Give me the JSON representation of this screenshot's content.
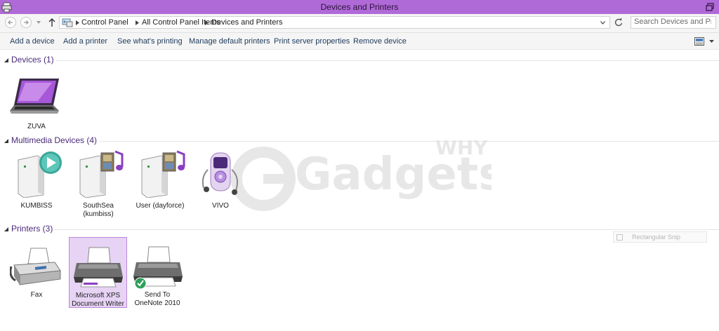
{
  "window": {
    "title": "Devices and Printers"
  },
  "address": {
    "crumbs": [
      "Control Panel",
      "All Control Panel Items",
      "Devices and Printers"
    ]
  },
  "search": {
    "placeholder": "Search Devices and Printers"
  },
  "commands": [
    "Add a device",
    "Add a printer",
    "See what's printing",
    "Manage default printers",
    "Print server properties",
    "Remove device"
  ],
  "groups": {
    "devices": {
      "title": "Devices (1)",
      "items": [
        "ZUVA"
      ]
    },
    "multimedia": {
      "title": "Multimedia Devices (4)",
      "items": [
        "KUMBISS",
        "SouthSea (kumbiss)",
        "User (dayforce)",
        "VIVO"
      ]
    },
    "printers": {
      "title": "Printers (3)",
      "items": [
        "Fax",
        "Microsoft XPS Document Writer",
        "Send To OneNote 2010"
      ]
    }
  },
  "snip": {
    "label": "Rectangular Snip"
  },
  "watermark": {
    "text": "Gadgets",
    "subtext": "WHY"
  },
  "colors": {
    "titlebar": "#b06ad8",
    "group_title": "#4a2a78",
    "selection": "#e7d3f4",
    "accent": "#9b4fd4"
  },
  "icons": {
    "app": "devices-printers-icon",
    "back": "back-arrow-icon",
    "forward": "forward-arrow-icon",
    "up": "up-arrow-icon",
    "refresh": "refresh-icon",
    "laptop": "laptop-icon",
    "media": "media-server-icon",
    "music": "music-note-icon",
    "play": "play-icon",
    "phone": "media-player-icon",
    "fax": "fax-icon",
    "printer": "printer-icon",
    "default": "default-check-icon"
  }
}
